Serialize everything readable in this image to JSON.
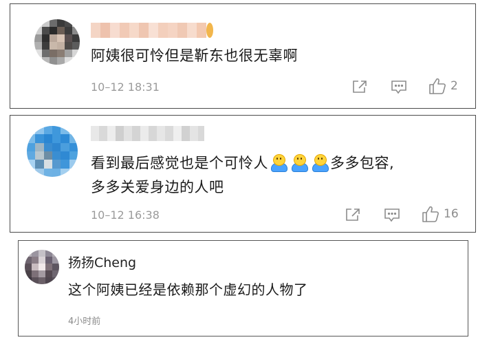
{
  "colors": {
    "border": "#4a4a4a",
    "text": "#1a1a1a",
    "meta": "#9a9a9a",
    "icon": "#8c8c8c"
  },
  "comments": [
    {
      "comment": "阿姨很可怜但是靳东也很无辜啊",
      "time": "10–12 18:31",
      "likes": "2",
      "icons": [
        "share-icon",
        "comment-icon",
        "like-icon"
      ]
    },
    {
      "comment_line1": "看到最后感觉也是个可怜人",
      "comment_line1_tail": "多多包容,",
      "comment_line2": "多多关爱身边的人吧",
      "emoji": "hug-emoji",
      "time": "10–12 16:38",
      "likes": "16",
      "icons": [
        "share-icon",
        "comment-icon",
        "like-icon"
      ]
    },
    {
      "username": "扬扬Cheng",
      "comment": "这个阿姨已经是依赖那个虚幻的人物了",
      "time": "4小时前"
    }
  ]
}
